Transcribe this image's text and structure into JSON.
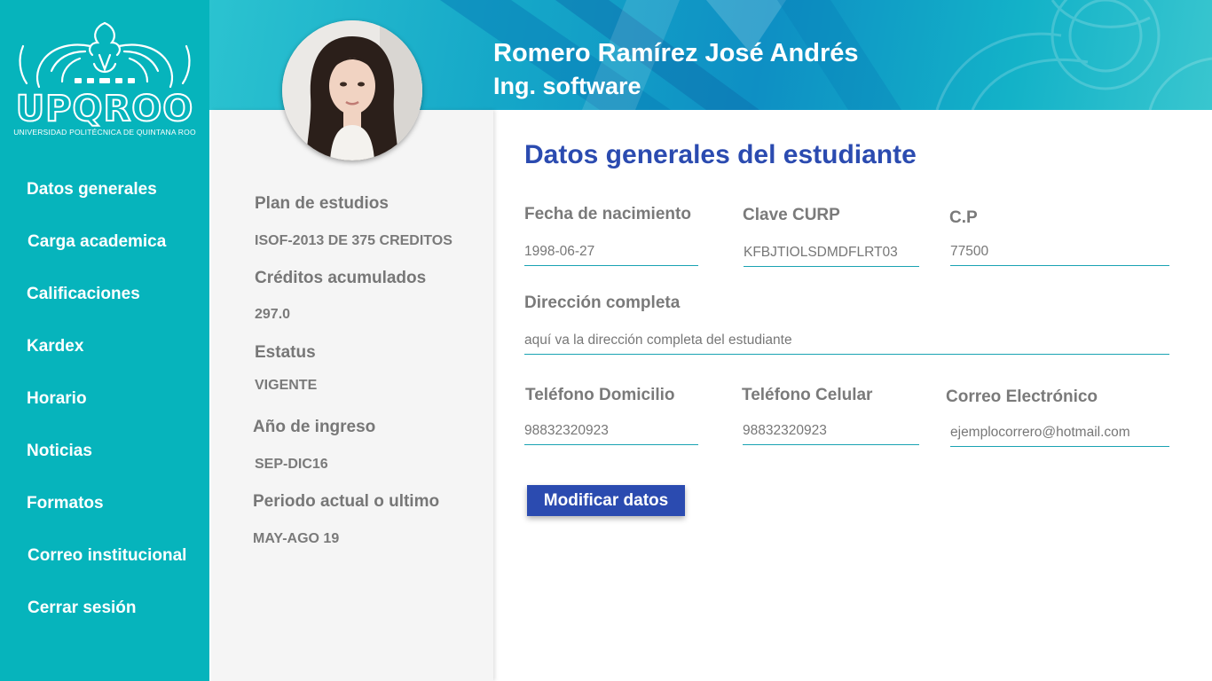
{
  "sidebar": {
    "logo_text": "UPQROO",
    "logo_subtitle": "UNIVERSIDAD POLITÉCNICA DE QUINTANA ROO",
    "items": [
      {
        "label": "Datos generales"
      },
      {
        "label": "Carga academica"
      },
      {
        "label": "Calificaciones"
      },
      {
        "label": "Kardex"
      },
      {
        "label": "Horario"
      },
      {
        "label": "Noticias"
      },
      {
        "label": "Formatos"
      },
      {
        "label": "Correo institucional"
      },
      {
        "label": "Cerrar sesión"
      }
    ]
  },
  "header": {
    "student_name": "Romero Ramírez José Andrés",
    "career": "Ing. software"
  },
  "info": {
    "plan_label": "Plan de estudios",
    "plan_value": "ISOF-2013 DE 375 CREDITOS",
    "credits_label": "Créditos acumulados",
    "credits_value": "297.0",
    "status_label": "Estatus",
    "status_value": "VIGENTE",
    "entry_label": "Año de ingreso",
    "entry_value": "SEP-DIC16",
    "period_label": "Periodo actual o ultimo",
    "period_value": "MAY-AGO 19"
  },
  "form": {
    "title": "Datos generales del estudiante",
    "birth_label": "Fecha de nacimiento",
    "birth_value": "1998-06-27",
    "curp_label": "Clave CURP",
    "curp_value": "KFBJTIOLSDMDFLRT03",
    "cp_label": "C.P",
    "cp_value": "77500",
    "address_label": "Dirección completa",
    "address_value": "aquí va la dirección completa del estudiante",
    "home_phone_label": "Teléfono Domicilio",
    "home_phone_value": "98832320923",
    "cell_phone_label": "Teléfono Celular",
    "cell_phone_value": "98832320923",
    "email_label": "Correo Electrónico",
    "email_value": "ejemplocorrero@hotmail.com",
    "modify_button": "Modificar datos"
  },
  "colors": {
    "sidebar": "#06b4bc",
    "accent_blue": "#2b4bb0",
    "panel": "#f5f5f5"
  }
}
